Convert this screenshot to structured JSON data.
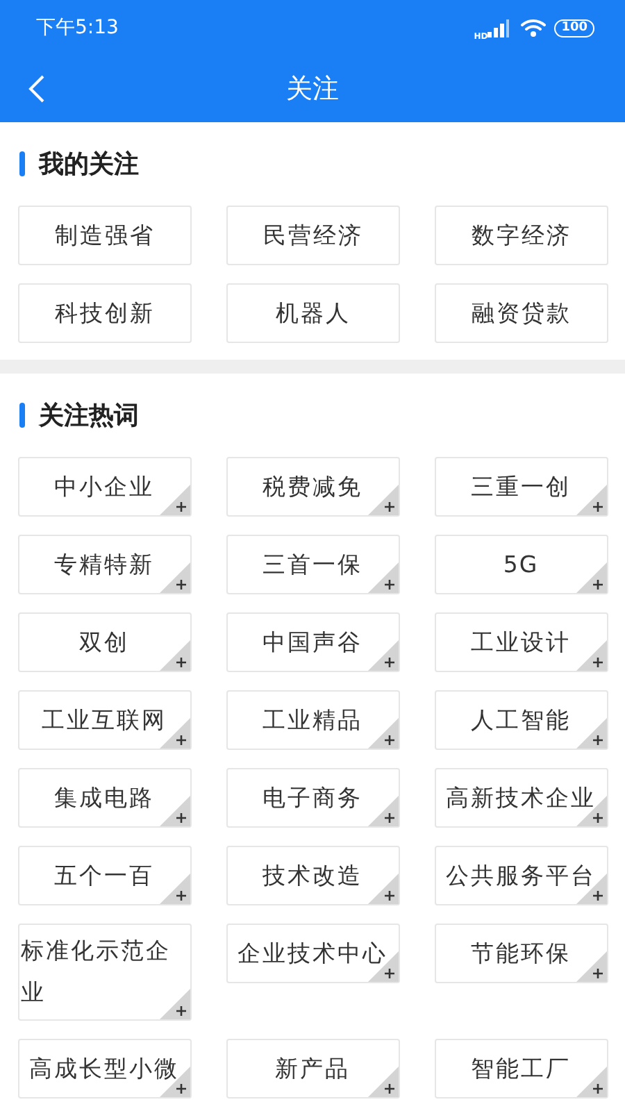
{
  "status_bar": {
    "time": "下午5:13",
    "network": "HD",
    "battery": "100"
  },
  "header": {
    "title": "关注"
  },
  "sections": [
    {
      "title": "我的关注",
      "kind": "followed",
      "tags": [
        "制造强省",
        "民营经济",
        "数字经济",
        "科技创新",
        "机器人",
        "融资贷款"
      ]
    },
    {
      "title": "关注热词",
      "kind": "hot",
      "tags": [
        "中小企业",
        "税费减免",
        "三重一创",
        "专精特新",
        "三首一保",
        "5G",
        "双创",
        "中国声谷",
        "工业设计",
        "工业互联网",
        "工业精品",
        "人工智能",
        "集成电路",
        "电子商务",
        "高新技术企业",
        "五个一百",
        "技术改造",
        "公共服务平台",
        "标准化示范企业",
        "企业技术中心",
        "节能环保",
        "高成长型小微",
        "新产品",
        "智能工厂"
      ]
    }
  ]
}
